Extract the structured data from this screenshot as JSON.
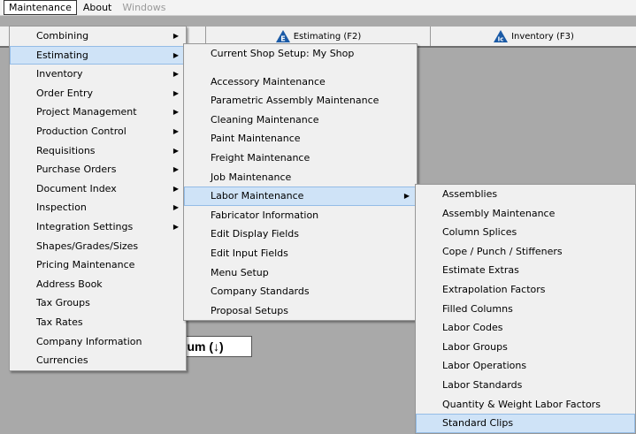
{
  "menubar": {
    "items": [
      "Maintenance",
      "About",
      "Windows"
    ]
  },
  "tabs": [
    {
      "label": "Estimating (F2)",
      "icon_letter": "E"
    },
    {
      "label": "Inventory (F3)",
      "icon_letter": "Ic"
    }
  ],
  "forum_label": "rum  (↓)",
  "maintenance_menu": {
    "items": [
      {
        "label": "Combining",
        "submenu": true
      },
      {
        "label": "Estimating",
        "submenu": true
      },
      {
        "label": "Inventory",
        "submenu": true
      },
      {
        "label": "Order Entry",
        "submenu": true
      },
      {
        "label": "Project Management",
        "submenu": true
      },
      {
        "label": "Production Control",
        "submenu": true
      },
      {
        "label": "Requisitions",
        "submenu": true
      },
      {
        "label": "Purchase Orders",
        "submenu": true
      },
      {
        "label": "Document Index",
        "submenu": true
      },
      {
        "label": "Inspection",
        "submenu": true
      },
      {
        "label": "Integration Settings",
        "submenu": true
      },
      {
        "label": "Shapes/Grades/Sizes",
        "submenu": false
      },
      {
        "label": "Pricing Maintenance",
        "submenu": false
      },
      {
        "label": "Address Book",
        "submenu": false
      },
      {
        "label": "Tax Groups",
        "submenu": false
      },
      {
        "label": "Tax Rates",
        "submenu": false
      },
      {
        "label": "Company Information",
        "submenu": false
      },
      {
        "label": "Currencies",
        "submenu": false
      }
    ]
  },
  "estimating_menu": {
    "header": "Current Shop Setup: My Shop",
    "items": [
      {
        "label": "Accessory Maintenance",
        "submenu": false
      },
      {
        "label": "Parametric Assembly Maintenance",
        "submenu": false
      },
      {
        "label": "Cleaning Maintenance",
        "submenu": false
      },
      {
        "label": "Paint Maintenance",
        "submenu": false
      },
      {
        "label": "Freight Maintenance",
        "submenu": false
      },
      {
        "label": "Job Maintenance",
        "submenu": false
      },
      {
        "label": "Labor Maintenance",
        "submenu": true
      },
      {
        "label": "Fabricator Information",
        "submenu": false
      },
      {
        "label": "Edit Display Fields",
        "submenu": false
      },
      {
        "label": "Edit Input Fields",
        "submenu": false
      },
      {
        "label": "Menu Setup",
        "submenu": false
      },
      {
        "label": "Company Standards",
        "submenu": false
      },
      {
        "label": "Proposal Setups",
        "submenu": false
      }
    ]
  },
  "labor_menu": {
    "items": [
      "Assemblies",
      "Assembly Maintenance",
      "Column Splices",
      "Cope / Punch / Stiffeners",
      "Estimate Extras",
      "Extrapolation Factors",
      "Filled Columns",
      "Labor Codes",
      "Labor Groups",
      "Labor Operations",
      "Labor Standards",
      "Quantity & Weight Labor Factors",
      "Standard Clips"
    ]
  },
  "colors": {
    "highlight": "#cfe3f7",
    "highlight_border": "#94bce6",
    "tab_icon": "#1a5aa6",
    "background": "#a9a9a9"
  }
}
